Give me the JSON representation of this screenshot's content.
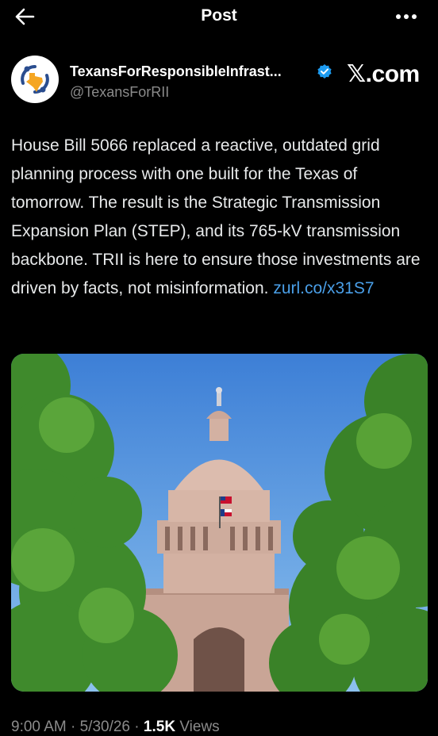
{
  "header": {
    "title": "Post",
    "back_icon": "arrow-left-icon",
    "more_icon": "more-horizontal-icon"
  },
  "author": {
    "display_name": "TexansForResponsibleInfrast...",
    "handle": "@TexansForRII",
    "verified_badge": "verified-badge-icon",
    "verified_color": "#1d9bf0"
  },
  "watermark": "𝕏.com",
  "post": {
    "text_before_link": "House Bill 5066 replaced a reactive, outdated grid planning process with one built for the Texas of tomorrow. The result is the Strategic Transmission Expansion Plan (STEP), and its 765-kV transmission backbone. TRII is here to ensure those investments are driven by facts, not misinformation. ",
    "link_text": "zurl.co/x31S7",
    "link_color": "#4a9fe8"
  },
  "meta": {
    "time": "9:00 AM",
    "separator": "·",
    "date": "5/30/26",
    "views_count": "1.5K",
    "views_label": "Views"
  }
}
